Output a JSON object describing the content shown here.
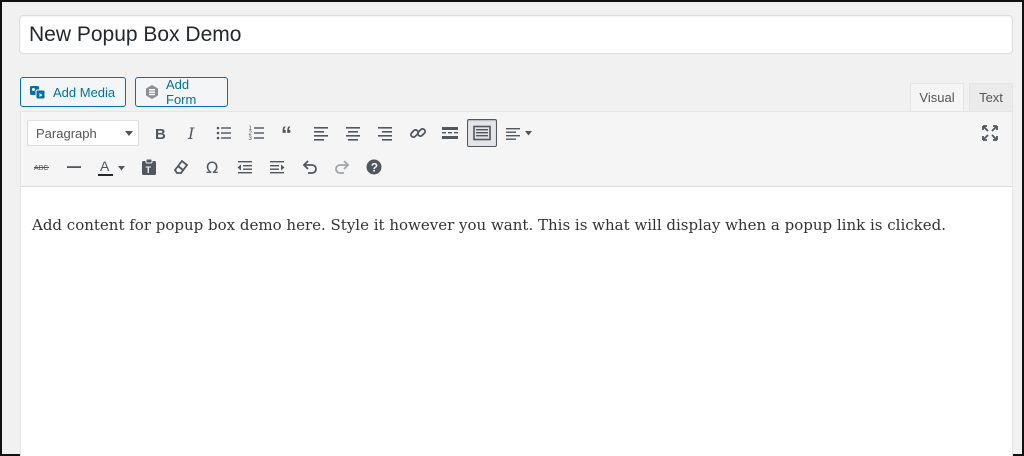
{
  "post": {
    "title": "New Popup Box Demo"
  },
  "media_buttons": {
    "add_media": "Add Media",
    "add_form": "Add Form"
  },
  "tabs": {
    "visual": "Visual",
    "text": "Text"
  },
  "toolbar": {
    "format_select": "Paragraph",
    "row1": [
      "bold-icon",
      "italic-icon",
      "bulleted-list-icon",
      "numbered-list-icon",
      "blockquote-icon",
      "align-left-icon",
      "align-center-icon",
      "align-right-icon",
      "link-icon",
      "read-more-icon",
      "toolbar-toggle-icon",
      "align-menu-icon"
    ],
    "row2": [
      "strikethrough-icon",
      "horizontal-line-icon",
      "text-color-icon",
      "paste-text-icon",
      "clear-formatting-icon",
      "special-character-icon",
      "outdent-icon",
      "indent-icon",
      "undo-icon",
      "redo-icon",
      "help-icon"
    ],
    "fullscreen": "fullscreen-icon"
  },
  "editor": {
    "content": "Add content for popup box demo here. Style it however you want. This is what will display when a popup link is clicked."
  },
  "colors": {
    "accent": "#0073aa",
    "toolbar_bg": "#f5f5f5",
    "icon": "#50575e"
  }
}
